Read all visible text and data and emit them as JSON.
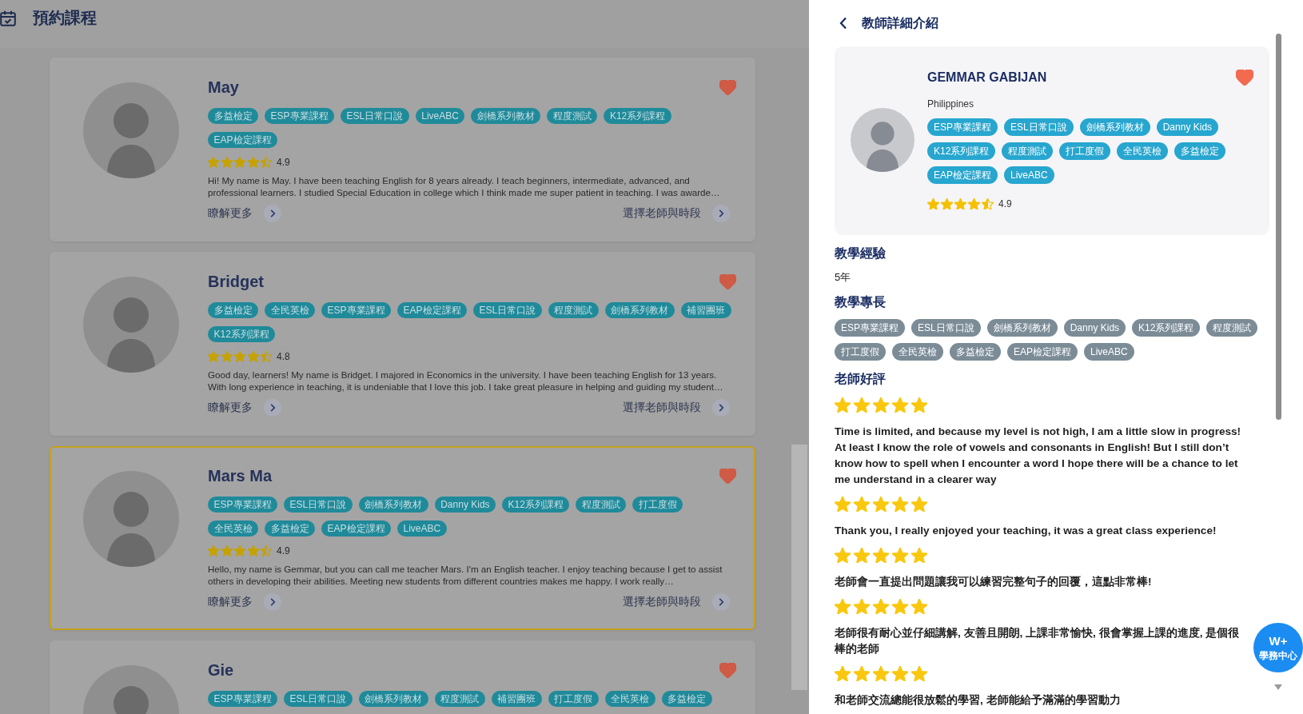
{
  "page": {
    "title": "預約課程"
  },
  "teachers": [
    {
      "name": "May",
      "favorited": true,
      "selected": false,
      "tags": [
        "多益檢定",
        "ESP專業課程",
        "ESL日常口說",
        "LiveABC",
        "劍橋系列教材",
        "程度測試",
        "K12系列課程",
        "EAP檢定課程"
      ],
      "stars": 4.5,
      "rating": "4.9",
      "intro": "Hi! My name is May. I have been teaching English for 8 years already. I teach beginners, intermediate, advanced, and professional learners. I studied Special Education in college which I think made me super patient in teaching. I was awarde…",
      "more_link": "瞭解更多",
      "choose_link": "選擇老師與時段"
    },
    {
      "name": "Bridget",
      "favorited": true,
      "selected": false,
      "tags": [
        "多益檢定",
        "全民英檢",
        "ESP專業課程",
        "EAP檢定課程",
        "ESL日常口說",
        "程度測試",
        "劍橋系列教材",
        "補習團班",
        "K12系列課程"
      ],
      "stars": 4.5,
      "rating": "4.8",
      "intro": "Good day, learners! My name is Bridget. I majored in Economics in the university. I have been teaching English for 13 years. With long experience in teaching, it is undeniable that I love this job. I take great pleasure in helping and guiding my student…",
      "more_link": "瞭解更多",
      "choose_link": "選擇老師與時段"
    },
    {
      "name": "Mars Ma",
      "favorited": true,
      "selected": true,
      "tags": [
        "ESP專業課程",
        "ESL日常口說",
        "劍橋系列教材",
        "Danny Kids",
        "K12系列課程",
        "程度測試",
        "打工度假",
        "全民英檢",
        "多益檢定",
        "EAP檢定課程",
        "LiveABC"
      ],
      "stars": 4.5,
      "rating": "4.9",
      "intro": "Hello, my name is Gemmar, but you can call me teacher Mars. I'm an English teacher. I enjoy teaching because I get to assist others in developing their abilities. Meeting new students from different countries makes me happy. I work really…",
      "more_link": "瞭解更多",
      "choose_link": "選擇老師與時段"
    },
    {
      "name": "Gie",
      "favorited": true,
      "selected": false,
      "tags": [
        "ESP專業課程",
        "ESL日常口說",
        "劍橋系列教材",
        "程度測試",
        "補習團班",
        "打工度假",
        "全民英檢",
        "多益檢定"
      ]
    }
  ],
  "detail_panel": {
    "title": "教師詳細介紹",
    "profile": {
      "name": "GEMMAR GABIJAN",
      "country": "Philippines",
      "favorited": true,
      "tags": [
        "ESP專業課程",
        "ESL日常口說",
        "劍橋系列教材",
        "Danny Kids",
        "K12系列課程",
        "程度測試",
        "打工度假",
        "全民英檢",
        "多益檢定",
        "EAP檢定課程",
        "LiveABC"
      ],
      "stars": 4.5,
      "rating": "4.9"
    },
    "sections": [
      {
        "kind": "text",
        "heading": "教學經驗",
        "text": "5年"
      },
      {
        "kind": "tags",
        "heading": "教學專長",
        "tags": [
          "ESP專業課程",
          "ESL日常口說",
          "劍橋系列教材",
          "Danny Kids",
          "K12系列課程",
          "程度測試",
          "打工度假",
          "全民英檢",
          "多益檢定",
          "EAP檢定課程",
          "LiveABC"
        ]
      },
      {
        "kind": "reviews",
        "heading": "老師好評",
        "reviews": [
          {
            "stars": 5,
            "text": "Time is limited, and because my level is not high, I am a little slow in progress! At least I know the role of vowels and consonants in English! But I still don’t know how to spell when I encounter a word I hope there will be a chance to let me understand in a clearer way"
          },
          {
            "stars": 5,
            "text": "Thank you, I really enjoyed your teaching, it was a great class experience!"
          },
          {
            "stars": 5,
            "text": "老師會一直提出問題讓我可以練習完整句子的回覆，這點非常棒!"
          },
          {
            "stars": 5,
            "text": "老師很有耐心並仔細講解, 友善且開朗, 上課非常愉快, 很會掌握上課的進度, 是個很棒的老師"
          },
          {
            "stars": 5,
            "text": "和老師交流總能很放鬆的學習, 老師能給予滿滿的學習動力"
          }
        ]
      }
    ]
  },
  "floating_button": {
    "lines": [
      "W+",
      "學務中心"
    ]
  }
}
